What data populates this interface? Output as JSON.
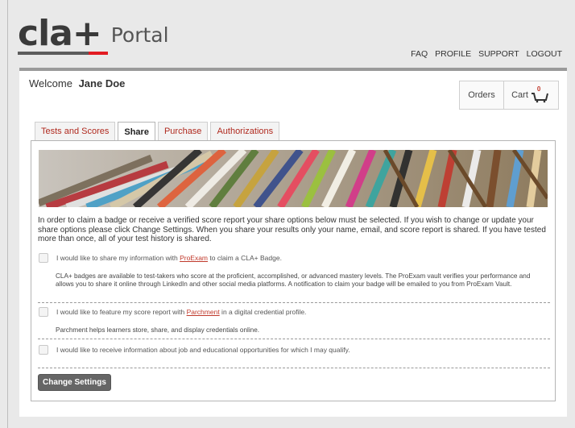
{
  "header": {
    "logo_mark": "cla+",
    "logo_portal": "Portal",
    "nav": [
      "FAQ",
      "PROFILE",
      "SUPPORT",
      "LOGOUT"
    ]
  },
  "welcome": {
    "prefix": "Welcome",
    "name": "Jane Doe"
  },
  "shop": {
    "orders_label": "Orders",
    "cart_label": "Cart",
    "cart_count": "0"
  },
  "tabs": [
    {
      "label": "Tests and Scores",
      "active": false
    },
    {
      "label": "Share",
      "active": true
    },
    {
      "label": "Purchase",
      "active": false
    },
    {
      "label": "Authorizations",
      "active": false
    }
  ],
  "share": {
    "intro": "In order to claim a badge or receive a verified score report your share options below must be selected. If you wish to change or update your share options please click Change Settings. When you share your results only your name, email, and score report is shared. If you have tested more than once, all of your test history is shared.",
    "option1": {
      "before": "I would like to share my information with ",
      "link": "ProExam",
      "after": " to claim a CLA+ Badge.",
      "checked": false,
      "description": "CLA+ badges are available to test-takers who score at the proficient, accomplished, or advanced mastery levels. The ProExam vault verifies your performance and allows you to share it online through LinkedIn and other social media platforms. A notification to claim your badge will be emailed to you from ProExam Vault."
    },
    "option2": {
      "before": "I would like to feature my score report with ",
      "link": "Parchment",
      "after": " in a digital credential profile.",
      "checked": false,
      "description": "Parchment helps learners store, share, and display credentials online."
    },
    "option3": {
      "label": "I would like to receive information about job and educational opportunities for which I may qualify.",
      "checked": false
    },
    "button_label": "Change Settings"
  },
  "colors": {
    "accent_red": "#e21b22",
    "tab_link": "#b02a1f",
    "button": "#666666"
  }
}
